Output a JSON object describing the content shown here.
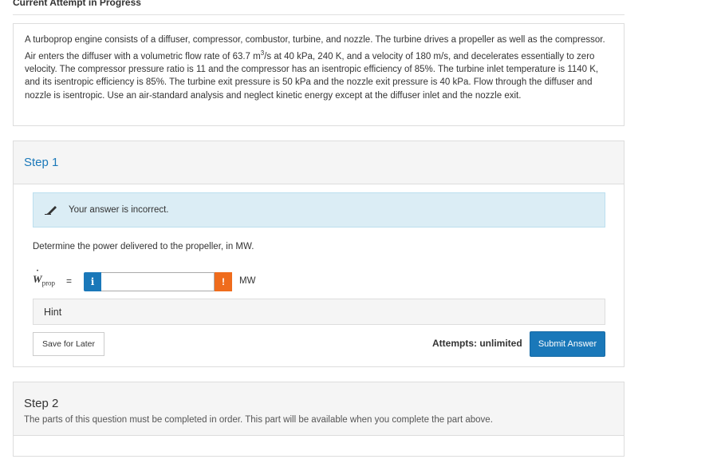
{
  "header": {
    "title": "Current Attempt in Progress"
  },
  "problem": {
    "text_before_sup": "A turboprop engine consists of a diffuser, compressor, combustor, turbine, and nozzle. The turbine drives a propeller as well as the compressor. Air enters the diffuser with a volumetric flow rate of 63.7 m",
    "sup": "3",
    "text_after_sup": "/s at 40 kPa, 240 K, and a velocity of 180 m/s, and decelerates essentially to zero velocity. The compressor pressure ratio is 11 and the compressor has an isentropic efficiency of 85%. The turbine inlet temperature is 1140 K, and its isentropic efficiency is 85%. The turbine exit pressure is 50 kPa and the nozzle exit pressure is 40 kPa. Flow through the diffuser and nozzle is isentropic. Use an air-standard analysis and neglect kinetic energy except at the diffuser inlet and the nozzle exit."
  },
  "step1": {
    "title": "Step 1",
    "feedback": "Your answer is incorrect.",
    "question": "Determine the power delivered to the propeller, in MW.",
    "variable": {
      "symbol": "W",
      "dot": "˙",
      "subscript": "prop",
      "equals": "="
    },
    "info_label": "i",
    "input": {
      "value": "",
      "placeholder": ""
    },
    "warning_label": "!",
    "unit": "MW",
    "hint_label": "Hint",
    "save_label": "Save for Later",
    "attempts_label": "Attempts: unlimited",
    "submit_label": "Submit Answer"
  },
  "step2": {
    "title": "Step 2",
    "note": "The parts of this question must be completed in order. This part will be available when you complete the part above."
  },
  "colors": {
    "accent": "#1a78b9",
    "feedback_bg": "#dbedf5",
    "warning": "#ef6c1d",
    "panel_bg": "#f5f5f5"
  },
  "icons": {
    "feedback": "pencil-icon",
    "info": "info-icon",
    "warning": "warning-icon"
  }
}
